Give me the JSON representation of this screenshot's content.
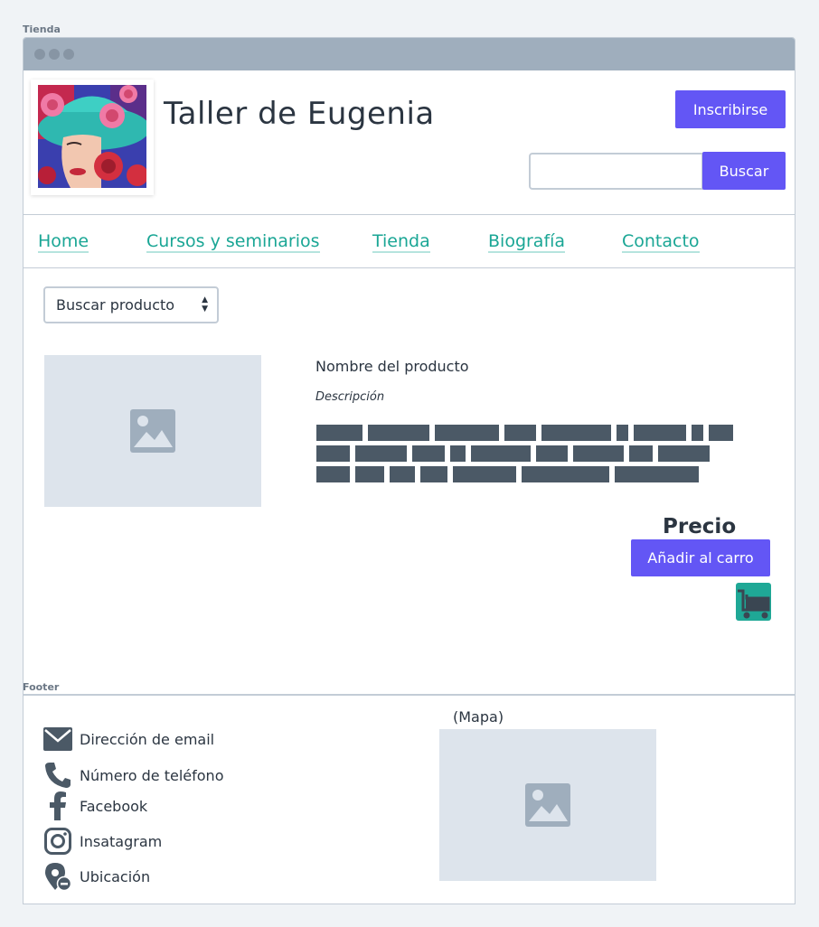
{
  "labels": {
    "page_frame": "Tienda",
    "footer_frame": "Footer"
  },
  "header": {
    "site_title": "Taller de Eugenia",
    "signup_label": "Inscribirse",
    "search_button_label": "Buscar",
    "search_placeholder": ""
  },
  "nav": {
    "items": [
      {
        "label": "Home"
      },
      {
        "label": "Cursos y seminarios"
      },
      {
        "label": "Tienda"
      },
      {
        "label": "Biografía"
      },
      {
        "label": "Contacto"
      }
    ]
  },
  "shop": {
    "product_select": "Buscar producto",
    "product_name": "Nombre del producto",
    "description_label": "Descripción",
    "price_label": "Precio",
    "add_to_cart_label": "Añadir al carro"
  },
  "footer": {
    "contacts": [
      {
        "label": "Dirección de email",
        "icon": "email-icon"
      },
      {
        "label": "Número de teléfono",
        "icon": "phone-icon"
      },
      {
        "label": "Facebook",
        "icon": "facebook-icon"
      },
      {
        "label": "Insatagram",
        "icon": "instagram-icon"
      },
      {
        "label": "Ubicación",
        "icon": "location-icon"
      }
    ],
    "map_label": "(Mapa)"
  },
  "colors": {
    "accent": "#6356f5",
    "link": "#1aa695",
    "cart": "#1fa896",
    "placeholder": "#dde4ec"
  }
}
